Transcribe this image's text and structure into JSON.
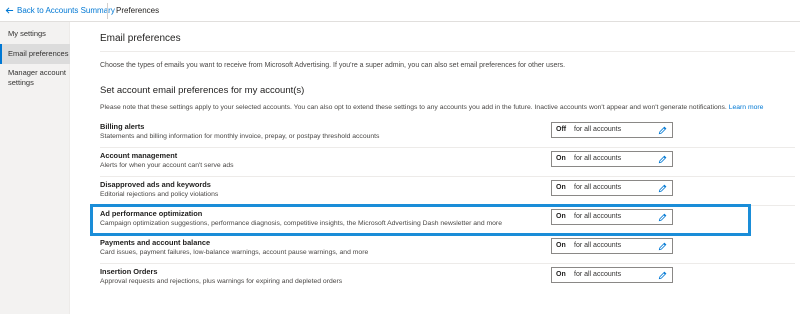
{
  "topbar": {
    "back_label": "Back to Accounts Summary",
    "page_label": "Preferences"
  },
  "sidebar": {
    "items": [
      {
        "label": "My settings",
        "active": false
      },
      {
        "label": "Email preferences",
        "active": true
      },
      {
        "label": "Manager account settings",
        "active": false
      }
    ]
  },
  "main": {
    "title": "Email preferences",
    "intro": "Choose the types of emails you want to receive from Microsoft Advertising. If you're a super admin, you can also set email preferences for other users.",
    "section_title": "Set account email preferences for my account(s)",
    "note": "Please note that these settings apply to your selected accounts. You can also opt to extend these settings to any accounts you add in the future. Inactive accounts won't appear and won't generate notifications.",
    "learn_more": "Learn more"
  },
  "preferences": [
    {
      "name": "Billing alerts",
      "description": "Statements and billing information for monthly invoice, prepay, or postpay threshold accounts",
      "value": "Off",
      "scope": "for all accounts"
    },
    {
      "name": "Account management",
      "description": "Alerts for when your account can't serve ads",
      "value": "On",
      "scope": "for all accounts"
    },
    {
      "name": "Disapproved ads and keywords",
      "description": "Editorial rejections and policy violations",
      "value": "On",
      "scope": "for all accounts"
    },
    {
      "name": "Ad performance optimization",
      "description": "Campaign optimization suggestions, performance diagnosis, competitive insights, the Microsoft Advertising Dash newsletter and more",
      "value": "On",
      "scope": "for all accounts"
    },
    {
      "name": "Payments and account balance",
      "description": "Card issues, payment failures, low-balance warnings, account pause warnings, and more",
      "value": "On",
      "scope": "for all accounts"
    },
    {
      "name": "Insertion Orders",
      "description": "Approval requests and rejections, plus warnings for expiring and depleted orders",
      "value": "On",
      "scope": "for all accounts"
    }
  ],
  "icons": {
    "back": "arrow-left-icon",
    "edit": "pencil-icon"
  },
  "colors": {
    "accent": "#0078d4",
    "highlight_border": "#1a8dd8"
  }
}
